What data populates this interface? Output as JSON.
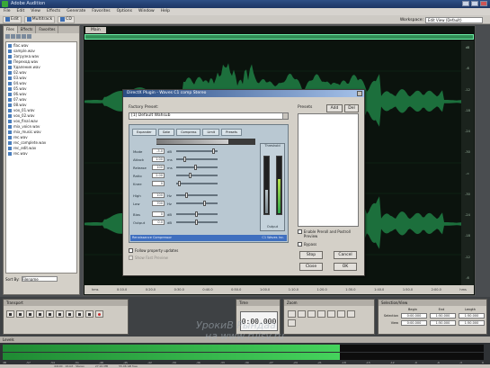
{
  "app": {
    "title": "Adobe Audition",
    "menu": [
      "File",
      "Edit",
      "View",
      "Effects",
      "Generate",
      "Favorites",
      "Options",
      "Window",
      "Help"
    ],
    "toolbar": {
      "edit_label": "Edit",
      "multitrack_label": "Multitrack",
      "cd_label": "CD"
    },
    "workspace_label": "Workspace:",
    "workspace_value": "Edit View (Default)"
  },
  "files_panel": {
    "tabs": [
      "Files",
      "Effects",
      "Favorites"
    ],
    "files": [
      "flac.wav",
      "sample.wav",
      "Загрузка.wav",
      "Переход.wav",
      "Удаление.wav",
      "02.wav",
      "03.wav",
      "04.wav",
      "05.wav",
      "06.wav",
      "07.wav",
      "08.wav",
      "vox_01.wav",
      "vox_02.wav",
      "vox_final.wav",
      "mix_voice.wav",
      "mix_music.wav",
      "rec.wav",
      "rec_complete.wav",
      "rec_edit.wav",
      "rec.wav"
    ],
    "sort_label": "Sort By:",
    "sort_value": "Filename"
  },
  "editor": {
    "tab": "Main",
    "db_scale": [
      "dB",
      "-6",
      "-12",
      "-18",
      "-24",
      "-30",
      "-∞",
      "-30",
      "-24",
      "-18",
      "-12",
      "-6"
    ],
    "timeline": [
      "hms",
      "0:10.0",
      "0:20.0",
      "0:30.0",
      "0:40.0",
      "0:50.0",
      "1:00.0",
      "1:10.0",
      "1:20.0",
      "1:30.0",
      "1:40.0",
      "1:50.0",
      "2:00.0",
      "hms"
    ]
  },
  "dialog": {
    "title": "DirectX Plugin - Waves C1 comp Stereo",
    "preset_label": "Factory Preset:",
    "preset_value": "[1] Default Wahsub",
    "plugin_tabs": [
      "Expander",
      "Gate",
      "Compress",
      "Limit",
      "Presets"
    ],
    "params": [
      {
        "name": "Mode",
        "value": "-3.0",
        "unit": "dB"
      },
      {
        "name": "Attack",
        "value": "1.00",
        "unit": "ms"
      },
      {
        "name": "Release",
        "value": "100",
        "unit": "ms"
      },
      {
        "name": "Ratio",
        "value": "2.00",
        "unit": ""
      },
      {
        "name": "Knee",
        "value": "0",
        "unit": ""
      },
      {
        "name": "High",
        "value": "100",
        "unit": "Hz"
      },
      {
        "name": "Low",
        "value": "700",
        "unit": "Hz"
      },
      {
        "name": "Bias",
        "value": "0",
        "unit": "dB"
      },
      {
        "name": "Output",
        "value": "0.0",
        "unit": "dB"
      }
    ],
    "meter_labels": {
      "top": "Threshold",
      "bottom": "Output"
    },
    "brand": "Renaissance Compressor",
    "footer": "C1 Waves Inc.",
    "chk_follow": "Follow property updates",
    "chk_fast": "Show Fast Preview",
    "presets_label": "Presets",
    "add_label": "Add",
    "del_label": "Del",
    "chk_enable": "Enable Preroll and Postroll Preview",
    "chk_bypass": "Bypass",
    "stop_label": "Stop",
    "cancel_label": "Cancel",
    "close_label": "Close",
    "ok_label": "OK"
  },
  "transport": {
    "title": "Transport",
    "time_title": "Time",
    "time_value": "0:00.000",
    "zoom_title": "Zoom"
  },
  "selection": {
    "title": "Selection/View",
    "headers": [
      "Begin",
      "End",
      "Length"
    ],
    "rows": [
      {
        "label": "Selection",
        "values": [
          "0:00.000",
          "1:50.000",
          "1:50.000"
        ]
      },
      {
        "label": "View",
        "values": [
          "0:00.000",
          "1:50.000",
          "1:50.000"
        ]
      }
    ]
  },
  "levels": {
    "title": "Levels",
    "fill_left": 0.7,
    "fill_right": 0.7,
    "ticks": [
      "dB",
      "-57",
      "-54",
      "-51",
      "-48",
      "-45",
      "-42",
      "-39",
      "-36",
      "-33",
      "-30",
      "-27",
      "-24",
      "-21",
      "-18",
      "-15",
      "-12",
      "-9",
      "-6",
      "-3",
      "0"
    ]
  },
  "status": [
    "44100 · 16-bit · Stereo",
    "27.91 MB",
    "55.06 GB free"
  ],
  "watermark": {
    "line1": "УрокиВ Рындаа",
    "line2": "на www.rulsv.ru"
  },
  "colors": {
    "waveform": "#1c6f3c",
    "overview": "#1c6f3c",
    "dialog_bg": "#d4d0c8",
    "plugin_bg": "#b9c8d2",
    "level_fill": "#2fa64a"
  }
}
